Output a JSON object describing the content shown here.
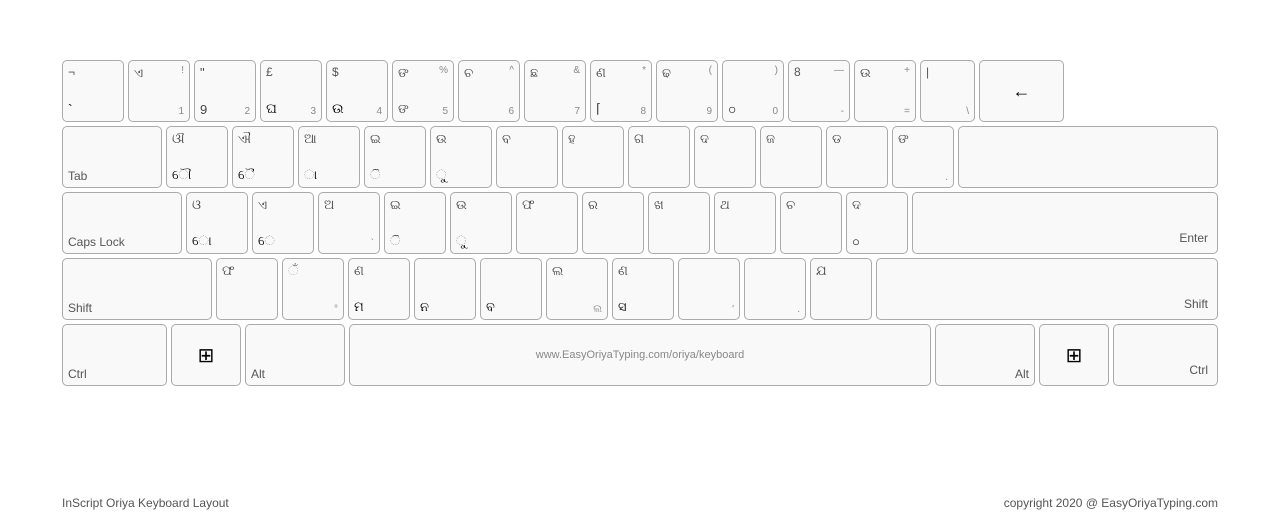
{
  "footer": {
    "left": "InScript Oriya Keyboard Layout",
    "right": "copyright 2020 @ EasyOriyaTyping.com"
  },
  "rows": [
    {
      "id": "row1",
      "keys": [
        {
          "id": "backtick",
          "tl": "¬",
          "tr": "",
          "bl": "` ",
          "br": ""
        },
        {
          "id": "1",
          "tl": "",
          "tr": "1",
          "bl": "ଏ",
          "br": "1"
        },
        {
          "id": "2",
          "tl": "\"",
          "tr": "",
          "bl": "9",
          "br": "2"
        },
        {
          "id": "3",
          "tl": "£",
          "tr": "",
          "bl": "ଘ3",
          "br": "3"
        },
        {
          "id": "4",
          "tl": "$",
          "tr": "",
          "bl": "ଉ4",
          "br": "4"
        },
        {
          "id": "5",
          "tl": "%",
          "tr": "",
          "bl": "ଙ5",
          "br": "5"
        },
        {
          "id": "6",
          "tl": "^",
          "tr": "",
          "bl": "ଚ6",
          "br": "6"
        },
        {
          "id": "7",
          "tl": "&",
          "tr": "",
          "bl": "ଛ7",
          "br": "7"
        },
        {
          "id": "8",
          "tl": "*",
          "tr": "",
          "bl": "⌈8",
          "br": "8"
        },
        {
          "id": "9",
          "tl": "(",
          "tr": "",
          "bl": "ଢ9",
          "br": "9"
        },
        {
          "id": "0",
          "tl": ")",
          "tr": "",
          "bl": "0",
          "br": "0"
        },
        {
          "id": "minus",
          "tl": "—",
          "tr": "",
          "bl": "8",
          "br": "-"
        },
        {
          "id": "equals",
          "tl": "+",
          "tr": "",
          "bl": "ଉ",
          "br": "="
        },
        {
          "id": "pipe",
          "tl": "",
          "tr": "",
          "bl": "|",
          "br": "\\"
        },
        {
          "id": "backspace",
          "tl": "",
          "tr": "",
          "bl": "←",
          "br": "",
          "wide": "backspace"
        }
      ]
    },
    {
      "id": "row2",
      "keys": [
        {
          "id": "tab",
          "tl": "Tab",
          "tr": "",
          "bl": "",
          "br": "",
          "wide": "tab"
        },
        {
          "id": "q",
          "tl": "",
          "tr": "",
          "bl": "ଔ",
          "br": "ୌ"
        },
        {
          "id": "w",
          "tl": "",
          "tr": "",
          "bl": "ଐ",
          "br": "ୈ"
        },
        {
          "id": "e",
          "tl": "",
          "tr": "",
          "bl": "ଆ",
          "br": "ା"
        },
        {
          "id": "r",
          "tl": "",
          "tr": "",
          "bl": "ଇ",
          "br": "ି"
        },
        {
          "id": "t",
          "tl": "",
          "tr": "",
          "bl": "ଉ",
          "br": "ୁ"
        },
        {
          "id": "y",
          "tl": "",
          "tr": "",
          "bl": "ବ",
          "br": ""
        },
        {
          "id": "u",
          "tl": "",
          "tr": "",
          "bl": "ହ",
          "br": ""
        },
        {
          "id": "i",
          "tl": "",
          "tr": "",
          "bl": "ଗ",
          "br": ""
        },
        {
          "id": "o",
          "tl": "",
          "tr": "",
          "bl": "ଦ",
          "br": ""
        },
        {
          "id": "p",
          "tl": "",
          "tr": "",
          "bl": "ଜ",
          "br": ""
        },
        {
          "id": "bracket-l",
          "tl": "",
          "tr": "",
          "bl": "ଡ",
          "br": ""
        },
        {
          "id": "bracket-r",
          "tl": "",
          "tr": "",
          "bl": "ଙ",
          "br": "."
        },
        {
          "id": "enter-top",
          "tl": "",
          "tr": "",
          "bl": "",
          "br": "",
          "wide": "enter-top"
        }
      ]
    },
    {
      "id": "row3",
      "keys": [
        {
          "id": "caps",
          "tl": "Caps Lock",
          "tr": "",
          "bl": "",
          "br": "",
          "wide": "caps"
        },
        {
          "id": "a",
          "tl": "",
          "tr": "",
          "bl": "ଓ",
          "br": "ୋ"
        },
        {
          "id": "s",
          "tl": "",
          "tr": "",
          "bl": "ଏ",
          "br": "େ"
        },
        {
          "id": "d",
          "tl": "",
          "tr": "",
          "bl": "ଅ",
          "br": ""
        },
        {
          "id": "f",
          "tl": "",
          "tr": "",
          "bl": "ଇ",
          "br": "ି"
        },
        {
          "id": "g",
          "tl": "",
          "tr": "",
          "bl": "ଉ",
          "br": "ୁ"
        },
        {
          "id": "h",
          "tl": "",
          "tr": "",
          "bl": "ଫ",
          "br": ""
        },
        {
          "id": "j",
          "tl": "",
          "tr": "",
          "bl": "ର",
          "br": ""
        },
        {
          "id": "k",
          "tl": "",
          "tr": "",
          "bl": "ଖ",
          "br": ""
        },
        {
          "id": "l",
          "tl": "",
          "tr": "",
          "bl": "ଥ",
          "br": ""
        },
        {
          "id": "semicolon",
          "tl": "",
          "tr": "",
          "bl": "ଚ",
          "br": ""
        },
        {
          "id": "quote",
          "tl": "",
          "tr": "",
          "bl": "ଦ",
          "br": ""
        },
        {
          "id": "enter",
          "tl": "",
          "tr": "",
          "bl": "Enter",
          "br": "",
          "wide": "enter"
        }
      ]
    },
    {
      "id": "row4",
      "keys": [
        {
          "id": "shift-left",
          "tl": "Shift",
          "tr": "",
          "bl": "",
          "br": "",
          "wide": "shift-left"
        },
        {
          "id": "z",
          "tl": "",
          "tr": "",
          "bl": "ଫ",
          "br": ""
        },
        {
          "id": "x",
          "tl": "",
          "tr": "",
          "bl": "ଁ",
          "br": "°"
        },
        {
          "id": "c",
          "tl": "",
          "tr": "",
          "bl": "ଣ",
          "br": "ମ"
        },
        {
          "id": "v",
          "tl": "",
          "tr": "",
          "bl": "",
          "br": "ନ"
        },
        {
          "id": "b",
          "tl": "",
          "tr": "",
          "bl": "",
          "br": "ବ"
        },
        {
          "id": "n",
          "tl": "",
          "tr": "",
          "bl": "ଲ",
          "br": ""
        },
        {
          "id": "m",
          "tl": "",
          "tr": "",
          "bl": "ଣ",
          "br": "ସ"
        },
        {
          "id": "comma",
          "tl": "",
          "tr": "",
          "bl": "",
          "br": "'"
        },
        {
          "id": "period",
          "tl": "",
          "tr": "",
          "bl": "",
          "br": "."
        },
        {
          "id": "slash",
          "tl": "",
          "tr": "",
          "bl": "ଯ",
          "br": ""
        },
        {
          "id": "shift-right",
          "tl": "Shift",
          "tr": "",
          "bl": "",
          "br": "",
          "wide": "shift-right"
        }
      ]
    },
    {
      "id": "row5",
      "keys": [
        {
          "id": "ctrl-left",
          "tl": "Ctrl",
          "tr": "",
          "bl": "",
          "br": "",
          "wide": "ctrl"
        },
        {
          "id": "win-left",
          "tl": "",
          "tr": "",
          "bl": "⊞",
          "br": "",
          "wide": "win"
        },
        {
          "id": "alt-left",
          "tl": "Alt",
          "tr": "",
          "bl": "",
          "br": "",
          "wide": "alt"
        },
        {
          "id": "space",
          "tl": "",
          "tr": "",
          "bl": "www.EasyOriyaTyping.com/oriya/keyboard",
          "br": "",
          "wide": "space"
        },
        {
          "id": "alt-right",
          "tl": "Alt",
          "tr": "",
          "bl": "",
          "br": "",
          "wide": "alt"
        },
        {
          "id": "win-right",
          "tl": "",
          "tr": "",
          "bl": "⊞",
          "br": "",
          "wide": "win"
        },
        {
          "id": "ctrl-right",
          "tl": "Ctrl",
          "tr": "",
          "bl": "",
          "br": "",
          "wide": "ctrl"
        }
      ]
    }
  ]
}
